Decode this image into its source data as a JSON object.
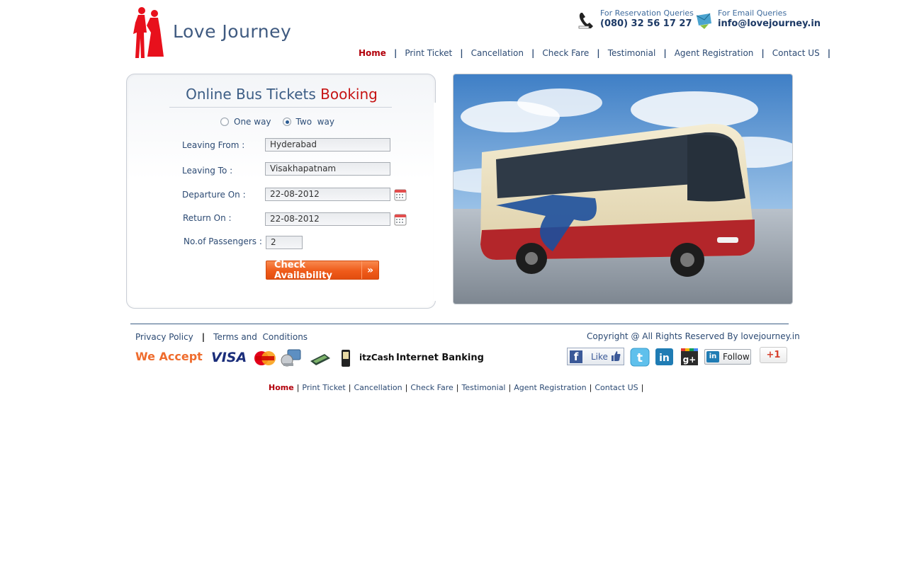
{
  "brand": {
    "name": "Love Journey"
  },
  "contact": {
    "reservation_label": "For Reservation Queries",
    "reservation_phone": "(080) 32 56 17 27",
    "email_label": "For Email Queries",
    "email": "info@lovejourney.in"
  },
  "nav": {
    "items": [
      {
        "label": "Home",
        "active": true
      },
      {
        "label": "Print Ticket"
      },
      {
        "label": "Cancellation"
      },
      {
        "label": "Check Fare"
      },
      {
        "label": "Testimonial"
      },
      {
        "label": "Agent Registration"
      },
      {
        "label": "Contact US"
      }
    ],
    "separator": "|"
  },
  "booking": {
    "title_main": "Online Bus Tickets ",
    "title_accent": "Booking",
    "trip_types": [
      {
        "label": "One way",
        "checked": false
      },
      {
        "label": "Two  way",
        "checked": true
      }
    ],
    "leaving_from_label": "Leaving From :",
    "leaving_from_value": "Hyderabad",
    "leaving_to_label": "Leaving To :",
    "leaving_to_value": "Visakhapatnam",
    "departure_label": "Departure On :",
    "departure_value": "22-08-2012",
    "return_label": "Return On :",
    "return_value": "22-08-2012",
    "passengers_label": "No.of Passengers :",
    "passengers_value": "2",
    "check_button": "Check Availability",
    "check_arrow": "»"
  },
  "footer": {
    "privacy": "Privacy Policy",
    "terms": "Terms and  Conditions",
    "separator": "|",
    "copyright": "Copyright @ All Rights Reserved By lovejourney.in",
    "we_accept": "We Accept",
    "payment_methods": {
      "visa": "VISA",
      "itzcash": "itzCash",
      "netbanking": "Internet Banking"
    },
    "social": {
      "fb_like": "Like",
      "li_follow": "Follow",
      "plus_one": "+1"
    }
  },
  "colors": {
    "brand_red": "#e8101c",
    "nav_active": "#b2000b",
    "link_blue": "#2c4a73",
    "button_orange": "#ef5b1a",
    "accept_orange": "#ef6c2d"
  }
}
